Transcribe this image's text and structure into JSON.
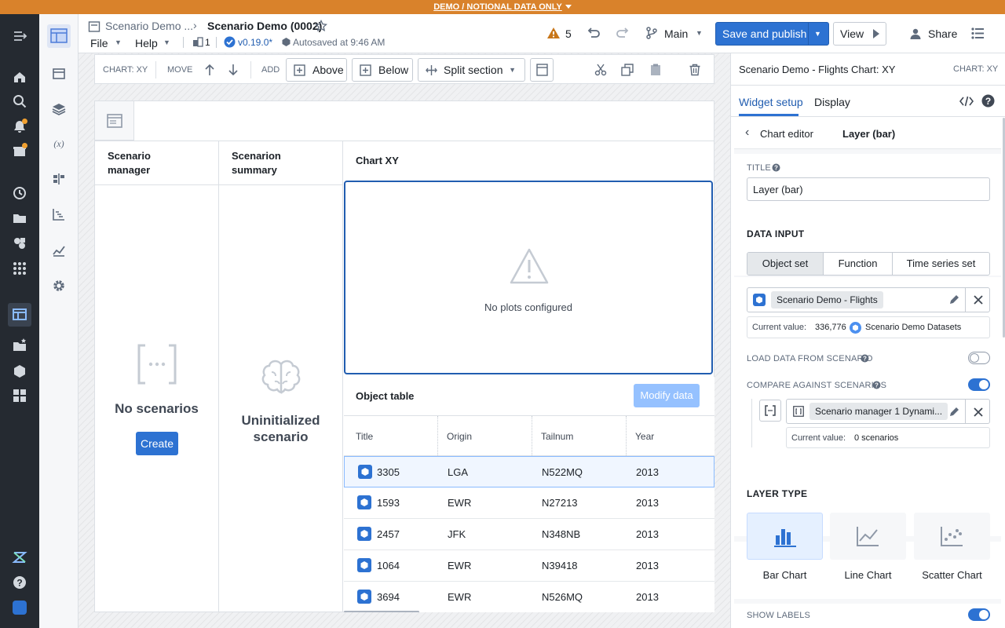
{
  "banner": "DEMO / NOTIONAL DATA ONLY",
  "header": {
    "breadcrumb_parent": "Scenario Demo ...",
    "title": "Scenario Demo (0002)",
    "menu_file": "File",
    "menu_help": "Help",
    "branch_count": "1",
    "version": "v0.19.0*",
    "autosave": "Autosaved at 9:46 AM",
    "warnings_count": "5",
    "branch": "Main",
    "save_publish": "Save and publish",
    "view": "View",
    "share": "Share"
  },
  "toolbar": {
    "chart_label": "CHART: XY",
    "move_label": "MOVE",
    "add_label": "ADD",
    "above": "Above",
    "below": "Below",
    "split": "Split section"
  },
  "layout": {
    "scenario_manager": "Scenario manager",
    "scenario_summary": "Scenarion summary",
    "chart_xy": "Chart XY",
    "no_plots": "No plots configured",
    "no_scenarios": "No scenarios",
    "create": "Create",
    "uninitialized": "Uninitialized scenario",
    "object_table": "Object table",
    "modify_data": "Modify data"
  },
  "table": {
    "headers": [
      "Title",
      "Origin",
      "Tailnum",
      "Year"
    ],
    "rows": [
      [
        "3305",
        "LGA",
        "N522MQ",
        "2013"
      ],
      [
        "1593",
        "EWR",
        "N27213",
        "2013"
      ],
      [
        "2457",
        "JFK",
        "N348NB",
        "2013"
      ],
      [
        "1064",
        "EWR",
        "N39418",
        "2013"
      ],
      [
        "3694",
        "EWR",
        "N526MQ",
        "2013"
      ]
    ]
  },
  "right_panel": {
    "title": "Scenario Demo - Flights Chart: XY",
    "type_label": "CHART: XY",
    "tab_setup": "Widget setup",
    "tab_display": "Display",
    "back_label": "Chart editor",
    "layer_title": "Layer (bar)",
    "title_label": "TITLE",
    "title_value": "Layer (bar)",
    "data_input": "DATA INPUT",
    "seg_object_set": "Object set",
    "seg_function": "Function",
    "seg_time_series": "Time series set",
    "object_set_value": "Scenario Demo - Flights",
    "current_value_label": "Current value:",
    "current_value_count": "336,776",
    "current_value_source": "Scenario Demo Datasets",
    "load_from_scenario": "LOAD DATA FROM SCENARIO",
    "compare_scenarios": "COMPARE AGAINST SCENARIOS",
    "scenario_manager_value": "Scenario manager 1 Dynami...",
    "current_value_label2": "Current value:",
    "current_value_scenarios": "0 scenarios",
    "layer_type": "LAYER TYPE",
    "bar_chart": "Bar Chart",
    "line_chart": "Line Chart",
    "scatter_chart": "Scatter Chart",
    "show_labels": "SHOW LABELS"
  },
  "colors": {
    "accent": "#2d72d2",
    "banner": "#d9822b",
    "rail": "#252a31",
    "warning": "#c87619"
  }
}
